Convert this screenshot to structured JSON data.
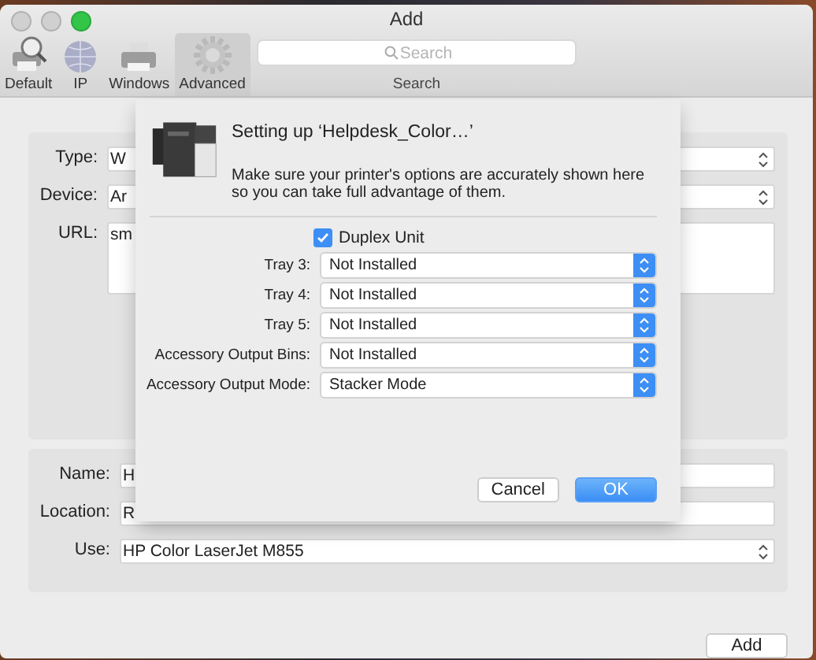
{
  "window": {
    "title": "Add"
  },
  "toolbar": {
    "items": [
      {
        "label": "Default",
        "kind": "default",
        "selected": false
      },
      {
        "label": "IP",
        "kind": "ip",
        "selected": false
      },
      {
        "label": "Windows",
        "kind": "windows",
        "selected": false
      },
      {
        "label": "Advanced",
        "kind": "advanced",
        "selected": true
      }
    ],
    "search": {
      "placeholder": "Search",
      "label": "Search"
    }
  },
  "connection": {
    "fields": [
      {
        "label": "Type:",
        "value": "W",
        "kind": "popup"
      },
      {
        "label": "Device:",
        "value": "Ar",
        "kind": "popup"
      },
      {
        "label": "URL:",
        "value": "sm",
        "kind": "textarea"
      }
    ]
  },
  "details": {
    "fields": [
      {
        "label": "Name:",
        "value": "H",
        "kind": "text"
      },
      {
        "label": "Location:",
        "value": "R",
        "kind": "text"
      },
      {
        "label": "Use:",
        "value": "HP Color LaserJet M855",
        "kind": "popup"
      }
    ]
  },
  "add_button": "Add",
  "sheet": {
    "title": "Setting up ‘Helpdesk_Color…’",
    "message": "Make sure your printer's options are accurately shown here so you can take full advantage of them.",
    "checkbox": {
      "label": "Duplex Unit",
      "checked": true
    },
    "options": [
      {
        "label": "Tray 3:",
        "value": "Not Installed"
      },
      {
        "label": "Tray 4:",
        "value": "Not Installed"
      },
      {
        "label": "Tray 5:",
        "value": "Not Installed"
      },
      {
        "label": "Accessory Output Bins:",
        "value": "Not Installed"
      },
      {
        "label": "Accessory Output Mode:",
        "value": "Stacker Mode"
      }
    ],
    "buttons": [
      {
        "label": "Cancel",
        "default": false
      },
      {
        "label": "OK",
        "default": true
      }
    ]
  }
}
